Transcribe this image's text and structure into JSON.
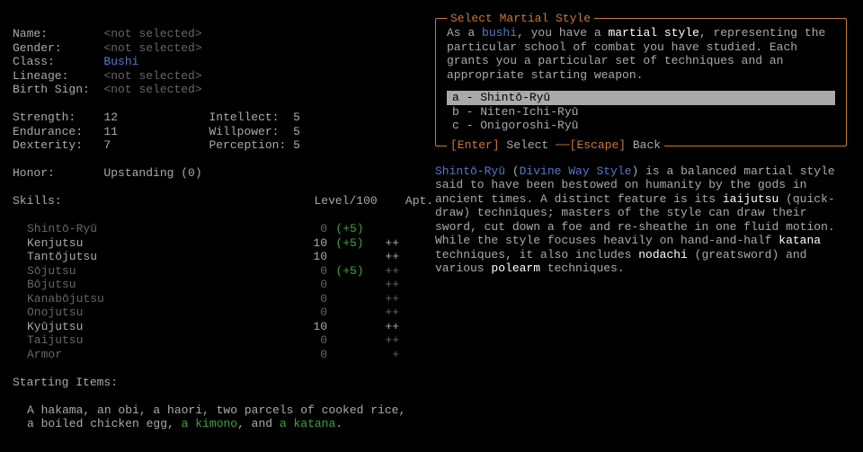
{
  "charinfo": {
    "name_label": "Name:",
    "name_value": "<not selected>",
    "gender_label": "Gender:",
    "gender_value": "<not selected>",
    "class_label": "Class:",
    "class_value": "Bushi",
    "lineage_label": "Lineage:",
    "lineage_value": "<not selected>",
    "birth_label": "Birth Sign:",
    "birth_value": "<not selected>"
  },
  "stats": {
    "left": [
      {
        "label": "Strength:",
        "value": "12"
      },
      {
        "label": "Endurance:",
        "value": "11"
      },
      {
        "label": "Dexterity:",
        "value": "7"
      }
    ],
    "right": [
      {
        "label": "Intellect:",
        "value": "5"
      },
      {
        "label": "Willpower:",
        "value": "5"
      },
      {
        "label": "Perception:",
        "value": "5"
      }
    ]
  },
  "honor": {
    "label": "Honor:",
    "value": "Upstanding (0)"
  },
  "skills": {
    "header": "Skills:",
    "col_level": "Level/100",
    "col_apt": "Apt.",
    "rows": [
      {
        "name": "Shintō-Ryū",
        "level": "0",
        "bonus": "(+5)",
        "apt": "",
        "dim": true
      },
      {
        "name": "Kenjutsu",
        "level": "10",
        "bonus": "(+5)",
        "apt": "++",
        "dim": false
      },
      {
        "name": "Tantōjutsu",
        "level": "10",
        "bonus": "",
        "apt": "++",
        "dim": false
      },
      {
        "name": "Sōjutsu",
        "level": "0",
        "bonus": "(+5)",
        "apt": "++",
        "dim": true
      },
      {
        "name": "Bōjutsu",
        "level": "0",
        "bonus": "",
        "apt": "++",
        "dim": true
      },
      {
        "name": "Kanabōjutsu",
        "level": "0",
        "bonus": "",
        "apt": "++",
        "dim": true
      },
      {
        "name": "Onojutsu",
        "level": "0",
        "bonus": "",
        "apt": "++",
        "dim": true
      },
      {
        "name": "Kyūjutsu",
        "level": "10",
        "bonus": "",
        "apt": "++",
        "dim": false
      },
      {
        "name": "Taijutsu",
        "level": "0",
        "bonus": "",
        "apt": "++",
        "dim": true
      },
      {
        "name": "Armor",
        "level": "0",
        "bonus": "",
        "apt": "+",
        "dim": true
      }
    ]
  },
  "starting": {
    "header": "Starting Items:",
    "pre": "A hakama, an obi, a haori, two parcels of cooked rice, a boiled chicken egg, ",
    "item1": "a kimono",
    "mid": ", and ",
    "item2": "a katana",
    "post": "."
  },
  "panel": {
    "title": "Select Martial Style",
    "intro_pre": "As a ",
    "intro_class": "bushi",
    "intro_mid": ", you have a ",
    "intro_bold": "martial style",
    "intro_post": ", representing the particular school of combat you have studied. Each grants you a particular set of techniques and an appropriate starting weapon.",
    "options": [
      {
        "key": "a",
        "name": "Shintō-Ryū",
        "selected": true
      },
      {
        "key": "b",
        "name": "Niten-Ichi-Ryū",
        "selected": false
      },
      {
        "key": "c",
        "name": "Onigoroshi-Ryū",
        "selected": false
      }
    ],
    "footer": {
      "enter": "[Enter]",
      "select": " Select ",
      "dash": "──",
      "escape": "[Escape]",
      "back": " Back"
    }
  },
  "desc": {
    "name": "Shintō-Ryū",
    "paren_open": " (",
    "subtitle": "Divine Way Style",
    "paren_close": ")",
    "t1": " is a balanced martial style said to have been bestowed on humanity by the gods in ancient times. A distinct feature is its ",
    "w1": "iaijutsu",
    "t2": " (quick-draw) techniques; masters of the style can draw their sword, cut down a foe and re-sheathe in one fluid motion. While the style focuses heavily on hand-and-half ",
    "w2": "katana",
    "t3": " techniques, it also includes ",
    "w3": "nodachi",
    "t4": " (greatsword) and various ",
    "w4": "polearm",
    "t5": " techniques."
  }
}
